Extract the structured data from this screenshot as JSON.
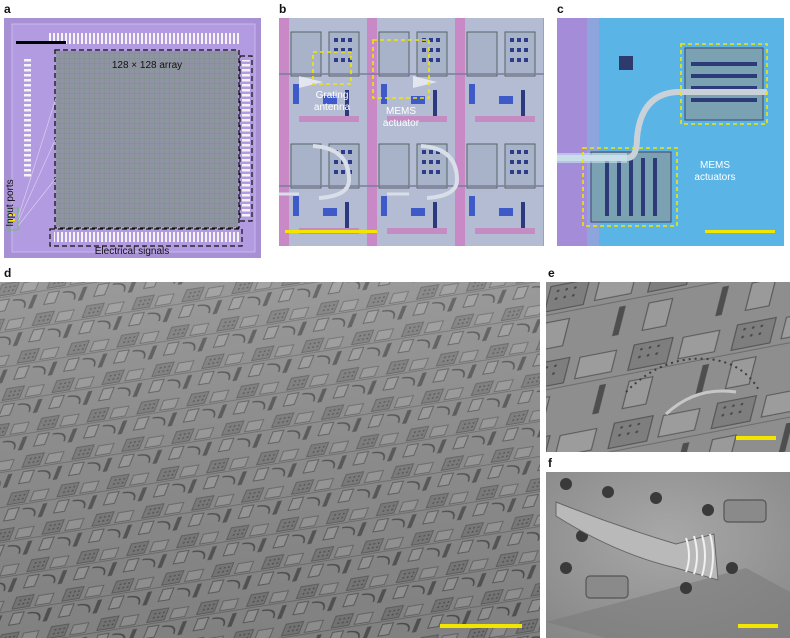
{
  "panels": {
    "a": {
      "letter": "a",
      "array_label": "128 × 128 array",
      "input_label": "Input ports",
      "signals_label": "Electrical signals"
    },
    "b": {
      "letter": "b",
      "grating_label_1": "Grating",
      "grating_label_2": "antenna",
      "mems_label_1": "MEMS",
      "mems_label_2": "actuator"
    },
    "c": {
      "letter": "c",
      "mems_label_1": "MEMS",
      "mems_label_2": "actuators"
    },
    "d": {
      "letter": "d"
    },
    "e": {
      "letter": "e"
    },
    "f": {
      "letter": "f"
    }
  },
  "colors": {
    "scale_bar": "#f2e600",
    "highlight_dash": "#f2e600",
    "chip_purple": "#a08ad2",
    "chip_blue": "#5fb6e8",
    "sem_gray": "#8a8a8a"
  }
}
